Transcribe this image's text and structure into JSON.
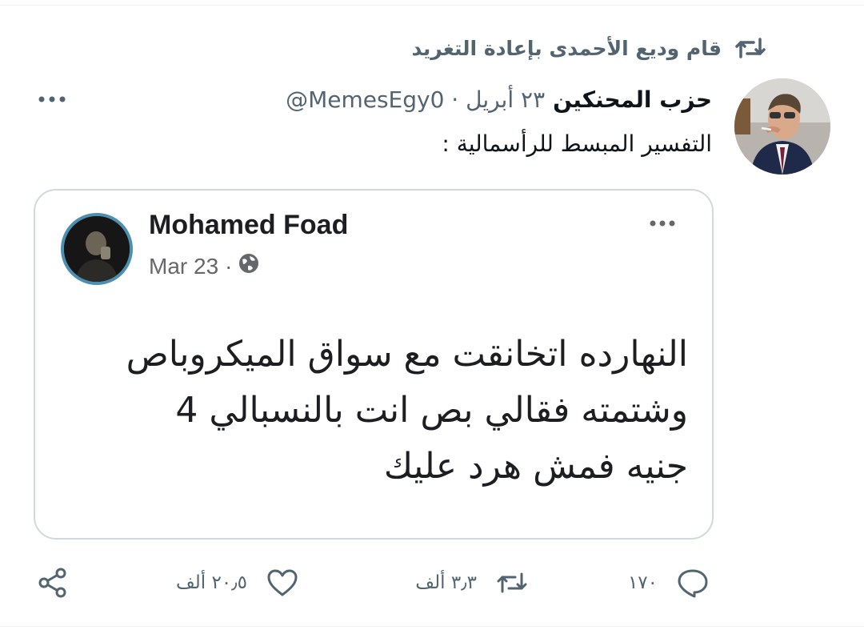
{
  "retweet": {
    "text": "قام وديع الأحمدى بإعادة التغريد",
    "icon": "retweet-icon"
  },
  "tweet": {
    "author_name": "حزب المحنكين",
    "handle_date": "@MemesEgy0 · ٢٣ أبريل",
    "text": "التفسير المبسط للرأسمالية :"
  },
  "embedded_post": {
    "author": "Mohamed Foad",
    "date": "Mar 23",
    "separator": "·",
    "lines": [
      "النهارده اتخانقت مع سواق الميكروباص",
      "وشتمته فقالي بص انت بالنسبالي 4",
      "جنيه فمش هرد عليك"
    ]
  },
  "actions": {
    "replies": "١٧٠",
    "retweets": "٣٫٣ ألف",
    "likes": "٢٠٫٥ ألف"
  },
  "colors": {
    "secondary_text": "#536471",
    "border": "#cfd9de",
    "fb_ring": "#4d8fb0"
  }
}
